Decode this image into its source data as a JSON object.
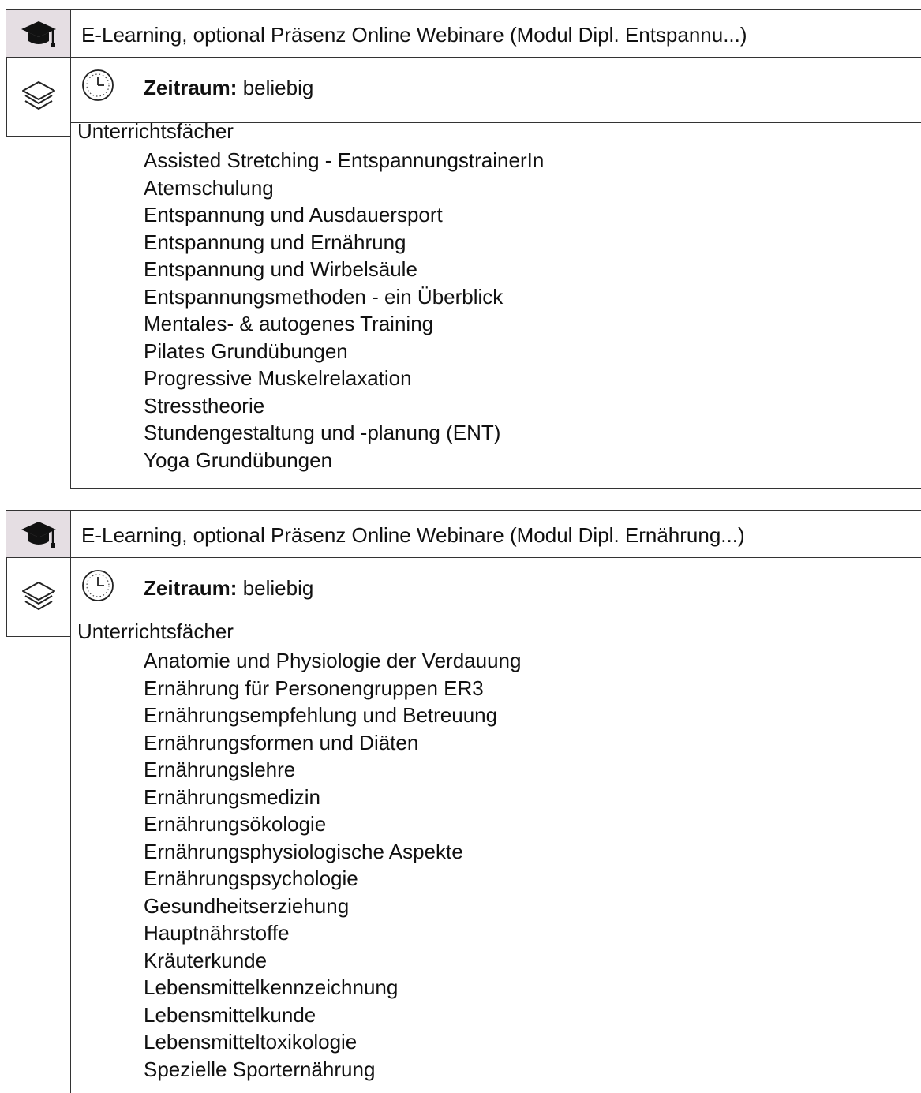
{
  "modules": [
    {
      "title": "E-Learning, optional Präsenz Online Webinare (Modul Dipl. Entspannu...)",
      "period_label": "Zeitraum:",
      "period_value": "beliebig",
      "subjects_heading": "Unterrichtsfächer",
      "subjects": [
        "Assisted Stretching - EntspannungstrainerIn",
        "Atemschulung",
        "Entspannung und Ausdauersport",
        "Entspannung und Ernährung",
        "Entspannung und Wirbelsäule",
        "Entspannungsmethoden - ein Überblick",
        "Mentales- & autogenes Training",
        "Pilates Grundübungen",
        "Progressive Muskelrelaxation",
        "Stresstheorie",
        "Stundengestaltung und -planung (ENT)",
        "Yoga Grundübungen"
      ]
    },
    {
      "title": "E-Learning, optional Präsenz Online Webinare (Modul Dipl. Ernährung...)",
      "period_label": "Zeitraum:",
      "period_value": "beliebig",
      "subjects_heading": "Unterrichtsfächer",
      "subjects": [
        "Anatomie und Physiologie der Verdauung",
        "Ernährung für Personengruppen ER3",
        "Ernährungsempfehlung und Betreuung",
        "Ernährungsformen und Diäten",
        "Ernährungslehre",
        "Ernährungsmedizin",
        "Ernährungsökologie",
        "Ernährungsphysiologische Aspekte",
        "Ernährungspsychologie",
        "Gesundheitserziehung",
        "Hauptnährstoffe",
        "Kräuterkunde",
        "Lebensmittelkennzeichnung",
        "Lebensmittelkunde",
        "Lebensmitteltoxikologie",
        "Spezielle Sporternährung"
      ]
    }
  ],
  "colors": {
    "icon_cell_background": "#e5dee3",
    "border": "#333333",
    "text": "#111111"
  },
  "icons": {
    "mode": "graduation-cap-icon",
    "category": "layers-icon",
    "period": "clock-icon"
  }
}
